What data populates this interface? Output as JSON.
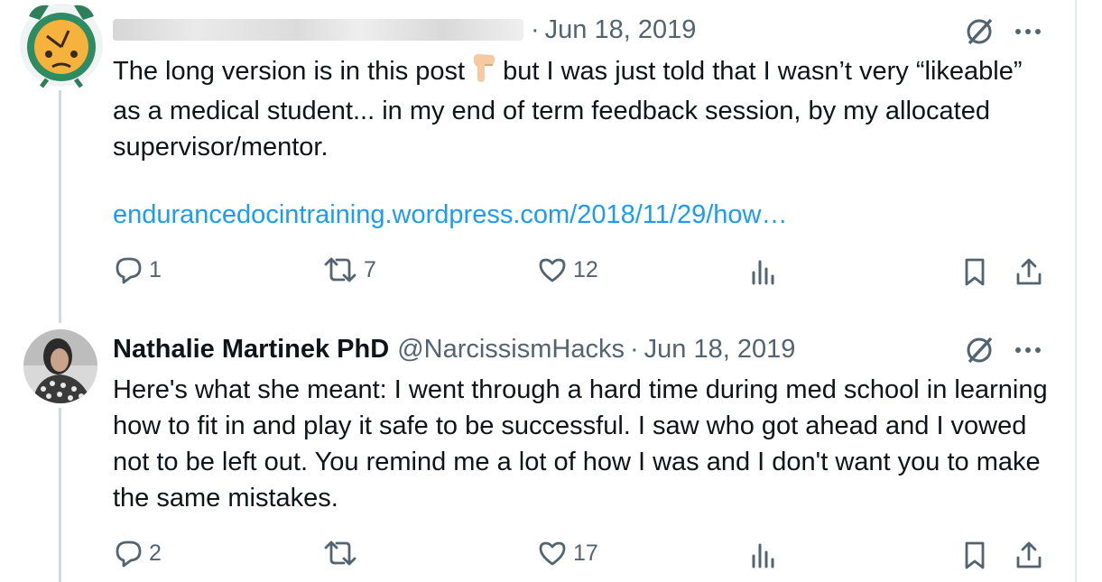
{
  "tweet1": {
    "date": "Jun 18, 2019",
    "dot": "·",
    "text_part1": "The long version is in this post",
    "text_part2": "but I was just told that I wasn’t very “likeable” as a medical student... in my end of term feedback session, by my allocated supervisor/mentor.",
    "link": "endurancedocintraining.wordpress.com/2018/11/29/how…",
    "replies": "1",
    "reposts": "7",
    "likes": "12"
  },
  "tweet2": {
    "name": "Nathalie Martinek PhD",
    "handle": "@NarcissismHacks",
    "dot": "·",
    "date": "Jun 18, 2019",
    "text": "Here's what she meant: I went through a hard time during med school in learning how to fit in and play it safe to be successful. I saw who got ahead and I vowed not to be left out. You remind me a lot of how I was and I don't want you to make the same mistakes.",
    "replies": "2",
    "reposts": "",
    "likes": "17"
  },
  "icons": {
    "grok": "grok-icon",
    "more": "more-dots-icon",
    "reply": "reply-icon",
    "repost": "repost-icon",
    "like": "like-icon",
    "views": "views-icon",
    "bookmark": "bookmark-icon",
    "share": "share-icon"
  },
  "colors": {
    "text": "#0f1419",
    "muted": "#536471",
    "link": "#1d9bf0",
    "line": "#cfd9de"
  }
}
